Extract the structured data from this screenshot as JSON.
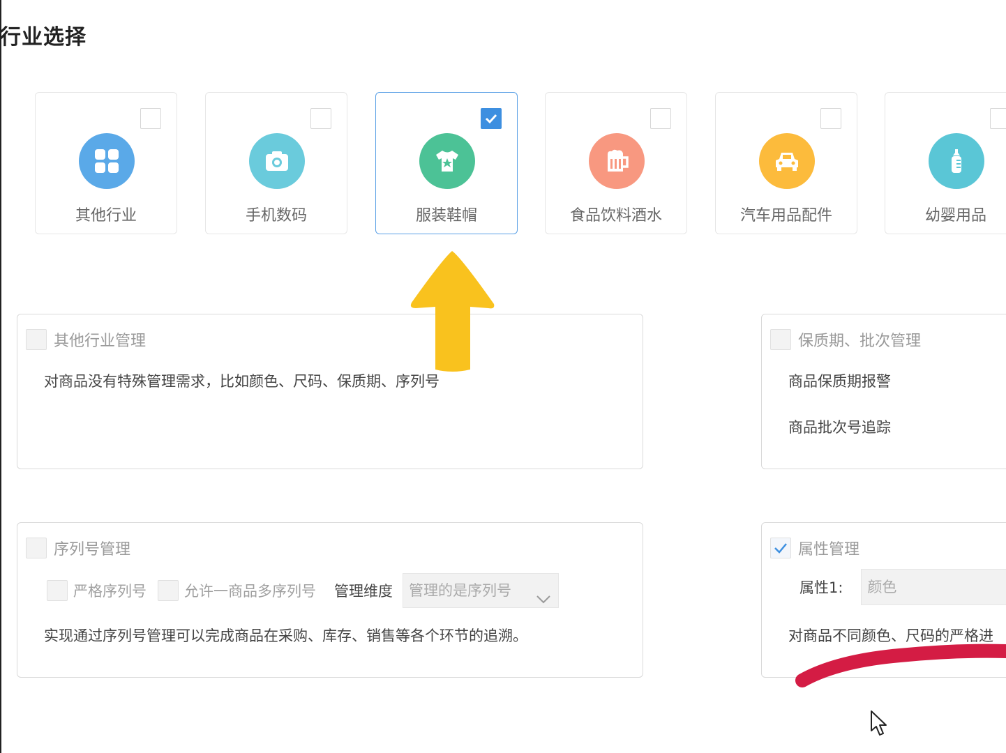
{
  "section_title": "行业选择",
  "industries": [
    {
      "label": "其他行业",
      "icon": "grid-icon",
      "color": "#5aa9e8",
      "checked": false
    },
    {
      "label": "手机数码",
      "icon": "camera-icon",
      "color": "#6acbdc",
      "checked": false
    },
    {
      "label": "服装鞋帽",
      "icon": "tshirt-icon",
      "color": "#4cc296",
      "checked": true
    },
    {
      "label": "食品饮料酒水",
      "icon": "beer-mug-icon",
      "color": "#f89880",
      "checked": false
    },
    {
      "label": "汽车用品配件",
      "icon": "car-icon",
      "color": "#fcbb3c",
      "checked": false
    },
    {
      "label": "幼婴用品",
      "icon": "baby-bottle-icon",
      "color": "#5ac6d6",
      "checked": false
    }
  ],
  "panels": {
    "other": {
      "title": "其他行业管理",
      "desc": "对商品没有特殊管理需求，比如颜色、尺码、保质期、序列号"
    },
    "shelf_life": {
      "title": "保质期、批次管理",
      "line1": "商品保质期报警",
      "line2": "商品批次号追踪"
    },
    "serial": {
      "title": "序列号管理",
      "option1": "严格序列号",
      "option2": "允许一商品多序列号",
      "dimension_label": "管理维度",
      "dimension_value": "管理的是序列号",
      "desc": "实现通过序列号管理可以完成商品在采购、库存、销售等各个环节的追溯。"
    },
    "attribute": {
      "title": "属性管理",
      "attr_label": "属性1:",
      "attr_value": "颜色",
      "desc": "对商品不同颜色、尺码的严格进"
    }
  },
  "colors": {
    "accent": "#3d8fe0",
    "arrow": "#f9c21e",
    "underline": "#d41c44"
  }
}
